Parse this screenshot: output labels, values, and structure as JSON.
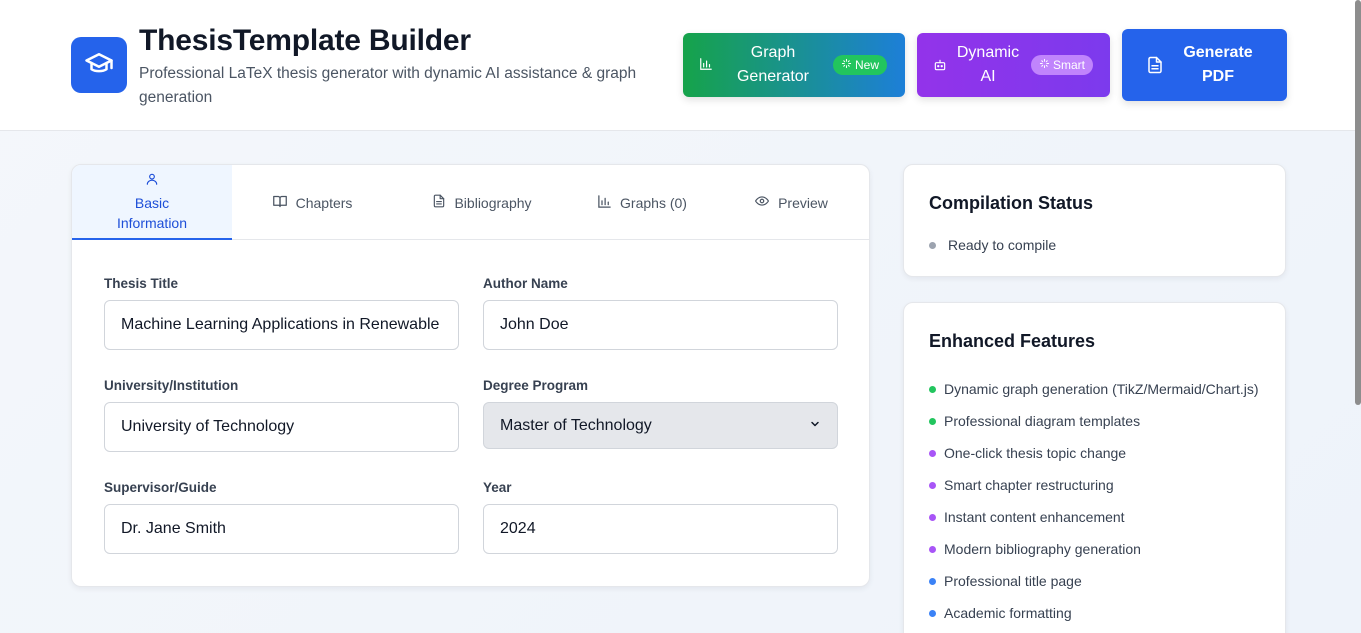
{
  "app": {
    "title": "ThesisTemplate Builder",
    "subtitle": "Professional LaTeX thesis generator with dynamic AI assistance & graph generation",
    "logo_icon": "graduation-cap-icon"
  },
  "header_buttons": {
    "graph": {
      "label": "Graph Generator",
      "badge": "New",
      "icon": "bar-chart-icon",
      "badge_icon": "sparkles-icon"
    },
    "ai": {
      "label": "Dynamic AI",
      "badge": "Smart",
      "icon": "bot-icon",
      "badge_icon": "sparkles-icon"
    },
    "pdf": {
      "label": "Generate PDF",
      "icon": "file-text-icon"
    }
  },
  "tabs": [
    {
      "label": "Basic Information",
      "icon": "user-icon",
      "active": true
    },
    {
      "label": "Chapters",
      "icon": "book-open-icon"
    },
    {
      "label": "Bibliography",
      "icon": "file-text-icon"
    },
    {
      "label": "Graphs (0)",
      "icon": "bar-chart-icon"
    },
    {
      "label": "Preview",
      "icon": "eye-icon"
    }
  ],
  "form": {
    "thesis_title": {
      "label": "Thesis Title",
      "value": "Machine Learning Applications in Renewable Energy Systems"
    },
    "author_name": {
      "label": "Author Name",
      "value": "John Doe"
    },
    "university": {
      "label": "University/Institution",
      "value": "University of Technology"
    },
    "degree": {
      "label": "Degree Program",
      "value": "Master of Technology"
    },
    "supervisor": {
      "label": "Supervisor/Guide",
      "value": "Dr. Jane Smith"
    },
    "year": {
      "label": "Year",
      "value": "2024"
    }
  },
  "compilation": {
    "title": "Compilation Status",
    "status": "Ready to compile",
    "status_color": "#9ca3af"
  },
  "features": {
    "title": "Enhanced Features",
    "items": [
      {
        "text": "Dynamic graph generation (TikZ/Mermaid/Chart.js)",
        "color": "#22c55e"
      },
      {
        "text": "Professional diagram templates",
        "color": "#22c55e"
      },
      {
        "text": "One-click thesis topic change",
        "color": "#a855f7"
      },
      {
        "text": "Smart chapter restructuring",
        "color": "#a855f7"
      },
      {
        "text": "Instant content enhancement",
        "color": "#a855f7"
      },
      {
        "text": "Modern bibliography generation",
        "color": "#a855f7"
      },
      {
        "text": "Professional title page",
        "color": "#3b82f6"
      },
      {
        "text": "Academic formatting",
        "color": "#3b82f6"
      }
    ]
  }
}
